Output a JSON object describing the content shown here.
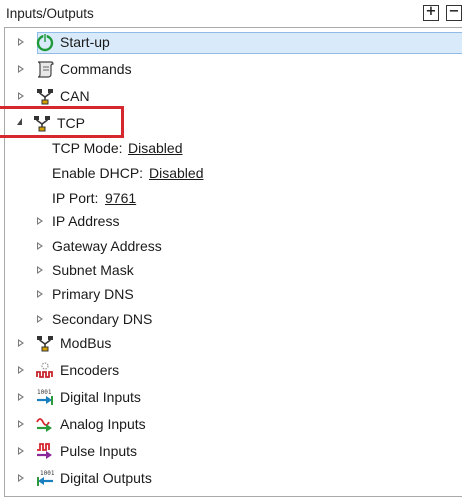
{
  "header": {
    "title": "Inputs/Outputs",
    "expand_all_symbol": "+",
    "collapse_all_symbol": "−"
  },
  "colors": {
    "selection": "#d9ebfb",
    "highlight": "#d6262e"
  },
  "tree": {
    "startup": {
      "label": "Start-up",
      "icon": "power-icon"
    },
    "commands": {
      "label": "Commands",
      "icon": "script-icon"
    },
    "can": {
      "label": "CAN",
      "icon": "network-icon"
    },
    "tcp": {
      "label": "TCP",
      "icon": "network-icon",
      "mode_label": "TCP Mode:",
      "mode_value": "Disabled",
      "dhcp_label": "Enable DHCP:",
      "dhcp_value": "Disabled",
      "port_label": "IP Port:",
      "port_value": "9761",
      "ip_address": "IP Address",
      "gateway": "Gateway Address",
      "subnet": "Subnet Mask",
      "primary_dns": "Primary DNS",
      "secondary_dns": "Secondary DNS"
    },
    "modbus": {
      "label": "ModBus",
      "icon": "network-icon"
    },
    "encoders": {
      "label": "Encoders",
      "icon": "encoder-icon"
    },
    "digital_inputs": {
      "label": "Digital Inputs",
      "icon": "digital-input-icon"
    },
    "analog_inputs": {
      "label": "Analog Inputs",
      "icon": "analog-input-icon"
    },
    "pulse_inputs": {
      "label": "Pulse Inputs",
      "icon": "pulse-input-icon"
    },
    "digital_outputs": {
      "label": "Digital Outputs",
      "icon": "digital-output-icon"
    }
  }
}
